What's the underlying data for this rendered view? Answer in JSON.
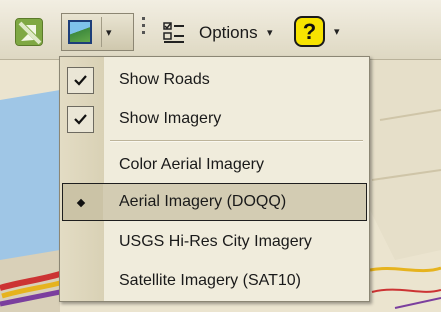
{
  "toolbar": {
    "nav_icon": "map-navigation-icon",
    "imagery_icon": "imagery-layer-icon",
    "options_icon": "options-checklist-icon",
    "options_label": "Options",
    "help_label": "?",
    "dropdown_glyph": "▾"
  },
  "menu": {
    "items": [
      {
        "label": "Show Roads",
        "state": "checked"
      },
      {
        "label": "Show Imagery",
        "state": "checked"
      },
      {
        "label": "Color Aerial Imagery",
        "state": "none"
      },
      {
        "label": "Aerial Imagery (DOQQ)",
        "state": "selected-radio"
      },
      {
        "label": "USGS Hi-Res City Imagery",
        "state": "none"
      },
      {
        "label": "Satellite Imagery (SAT10)",
        "state": "none"
      }
    ]
  },
  "colors": {
    "toolbar_bg": "#e8e4d4",
    "menu_bg": "#f0ecdc",
    "help_yellow": "#f7e300",
    "map_bg": "#ece6d3"
  }
}
